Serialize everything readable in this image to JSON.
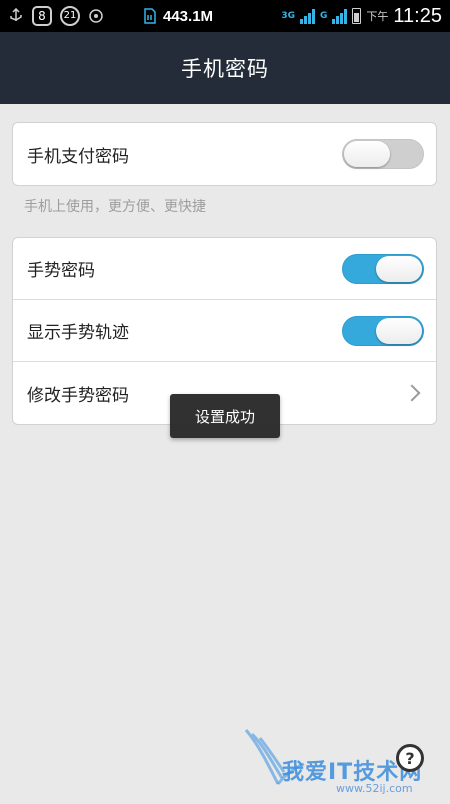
{
  "status_bar": {
    "badge_left": "8",
    "circle_badge": "21",
    "net_speed": "443.1M",
    "network_a": "3G",
    "network_b": "G",
    "ampm": "下午",
    "time": "11:25",
    "icons": [
      "usb-icon",
      "notification-badge",
      "circle-badge",
      "sync-icon",
      "sim-icon",
      "signal-icon",
      "battery-icon"
    ]
  },
  "header": {
    "title": "手机密码"
  },
  "section1": {
    "items": [
      {
        "label": "手机支付密码",
        "toggle": "off"
      }
    ],
    "hint": "手机上使用，更方便、更快捷"
  },
  "section2": {
    "items": [
      {
        "label": "手势密码",
        "toggle": "on"
      },
      {
        "label": "显示手势轨迹",
        "toggle": "on"
      },
      {
        "label": "修改手势密码",
        "control": "chevron"
      }
    ]
  },
  "toast": {
    "message": "设置成功"
  },
  "help": {
    "symbol": "?"
  },
  "watermark": {
    "text": "我爱IT技术网",
    "url": "www.52ij.com"
  },
  "colors": {
    "status_bar_bg": "#000000",
    "header_bg": "#242c39",
    "page_bg": "#e9e9e9",
    "toggle_on": "#36a9dc",
    "toggle_off": "#cfcfcf"
  }
}
